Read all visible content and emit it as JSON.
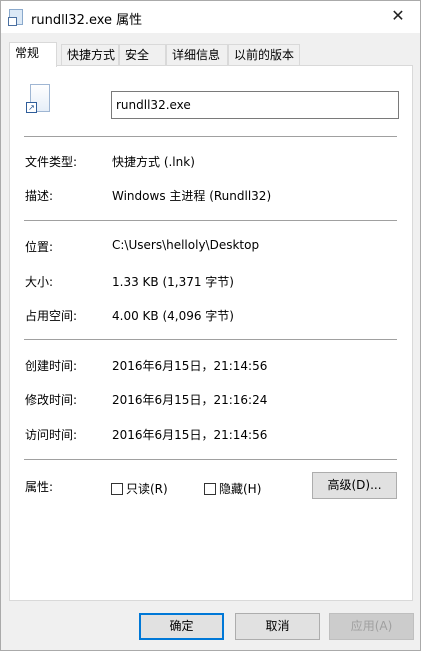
{
  "window": {
    "title": "rundll32.exe 属性",
    "close_glyph": "✕"
  },
  "tabs": [
    {
      "label": "常规",
      "active": true
    },
    {
      "label": "快捷方式",
      "active": false
    },
    {
      "label": "安全",
      "active": false
    },
    {
      "label": "详细信息",
      "active": false
    },
    {
      "label": "以前的版本",
      "active": false
    }
  ],
  "general": {
    "file_icon": "shortcut-file-icon",
    "file_name": "rundll32.exe",
    "type_label": "文件类型:",
    "type_value": "快捷方式 (.lnk)",
    "description_label": "描述:",
    "description_value": "Windows 主进程 (Rundll32)",
    "location_label": "位置:",
    "location_value": "C:\\Users\\helloly\\Desktop",
    "size_label": "大小:",
    "size_value": "1.33 KB (1,371 字节)",
    "size_on_disk_label": "占用空间:",
    "size_on_disk_value": "4.00 KB (4,096 字节)",
    "created_label": "创建时间:",
    "created_value": "2016年6月15日，21:14:56",
    "modified_label": "修改时间:",
    "modified_value": "2016年6月15日，21:16:24",
    "accessed_label": "访问时间:",
    "accessed_value": "2016年6月15日，21:14:56",
    "attributes_label": "属性:",
    "readonly_label": "只读(R)",
    "readonly_checked": false,
    "hidden_label": "隐藏(H)",
    "hidden_checked": false,
    "advanced_button": "高级(D)..."
  },
  "footer": {
    "ok_button": "确定",
    "cancel_button": "取消",
    "apply_button": "应用(A)"
  }
}
